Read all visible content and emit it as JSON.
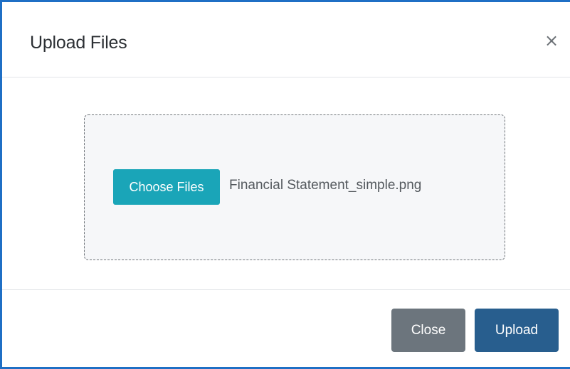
{
  "modal": {
    "title": "Upload Files",
    "close_icon_glyph": "×",
    "close_icon_name": "close-icon"
  },
  "dropzone": {
    "choose_button_label": "Choose Files",
    "selected_file_name": "Financial Statement_simple.png"
  },
  "footer": {
    "close_label": "Close",
    "upload_label": "Upload"
  },
  "colors": {
    "frame_accent": "#1f6fc5",
    "choose_button": "#1aa5b8",
    "close_button": "#6c757d",
    "upload_button": "#285e8e",
    "dropzone_background": "#f6f7f9"
  }
}
